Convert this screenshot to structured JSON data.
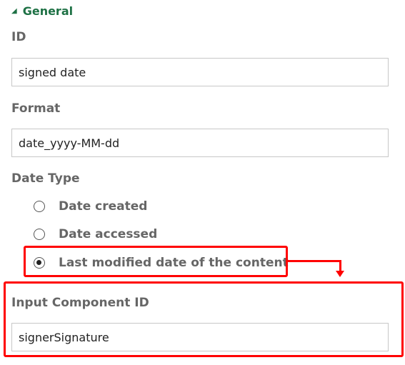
{
  "general": {
    "header_label": "General"
  },
  "id_field": {
    "label": "ID",
    "value": "signed date"
  },
  "format_field": {
    "label": "Format",
    "value": "date_yyyy-MM-dd"
  },
  "date_type": {
    "label": "Date Type",
    "options": [
      {
        "label": "Date created",
        "checked": false
      },
      {
        "label": "Date accessed",
        "checked": false
      },
      {
        "label": "Last modified date of the content",
        "checked": true
      }
    ]
  },
  "input_component": {
    "label": "Input Component ID",
    "value": "signerSignature"
  },
  "colors": {
    "header_accent": "#1e7145",
    "highlight": "#ff0000"
  },
  "icons": {
    "section_toggle": "triangle-expanded-icon"
  }
}
